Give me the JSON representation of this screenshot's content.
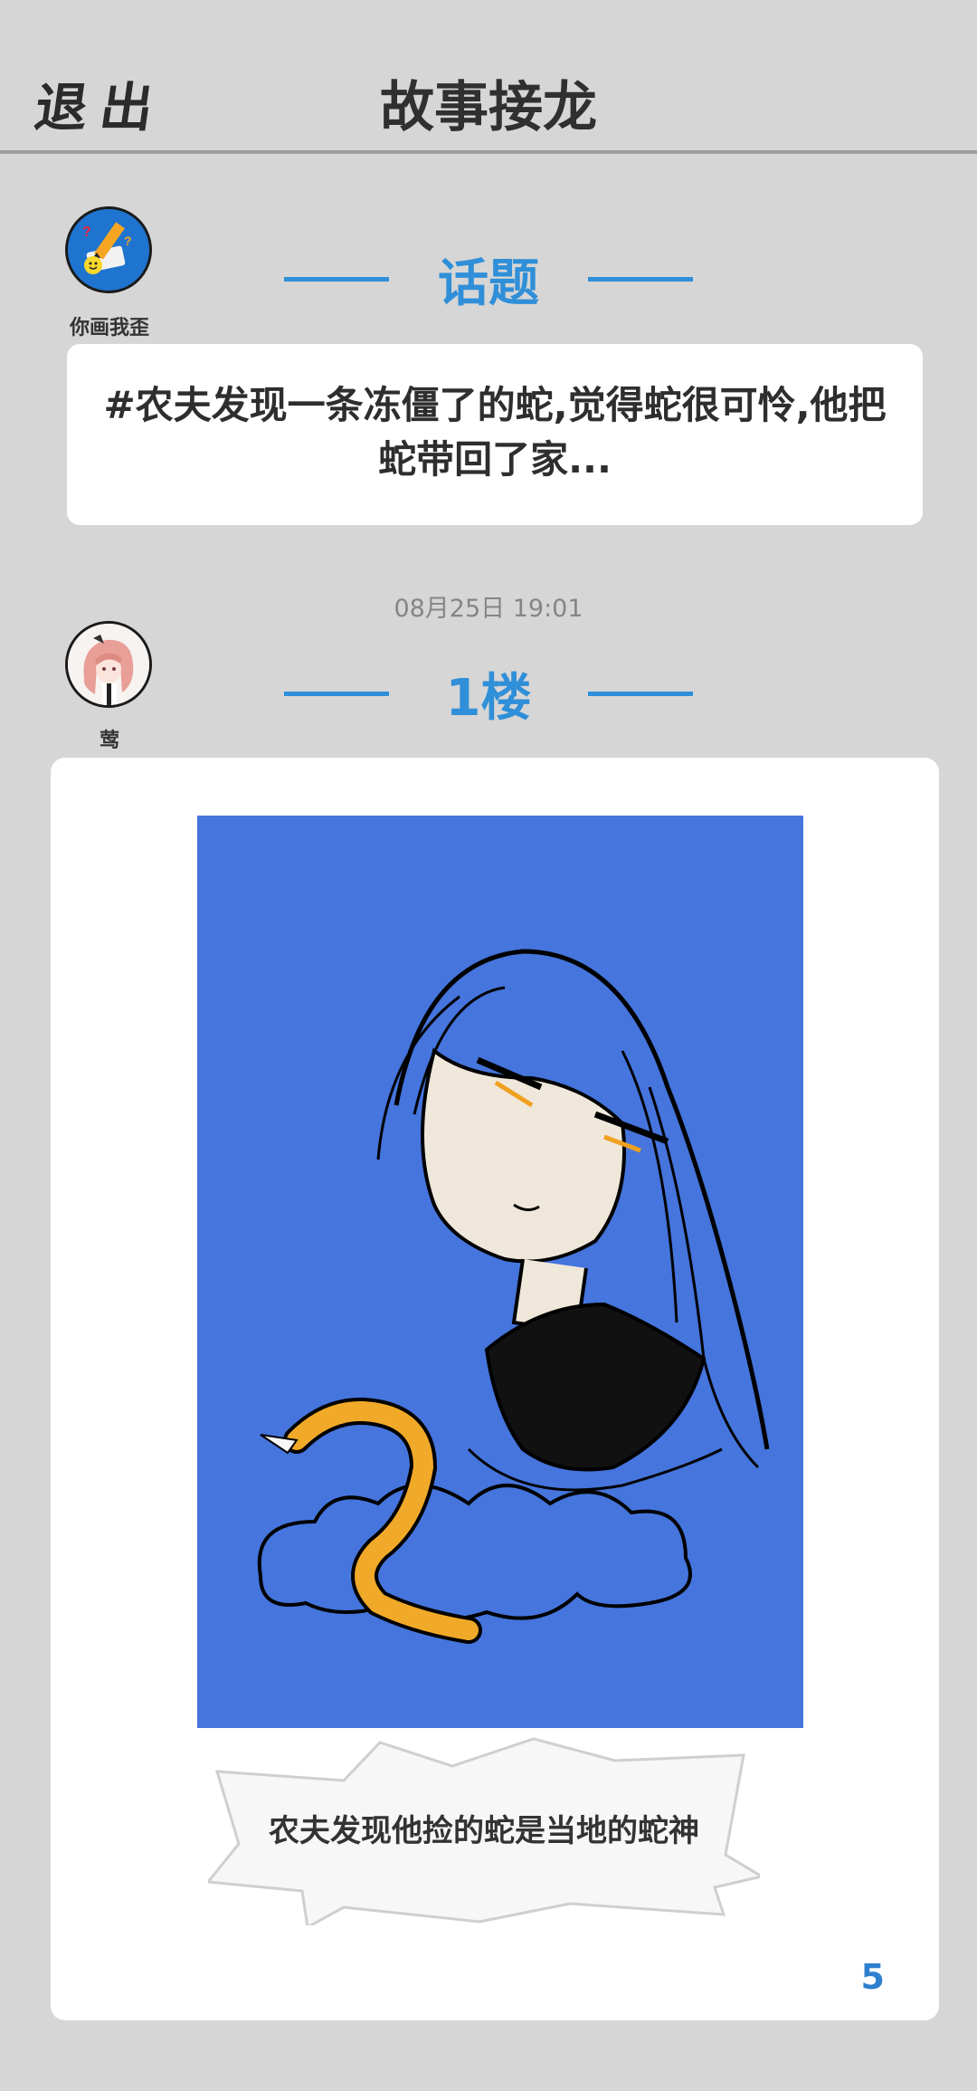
{
  "header": {
    "exit_label": "退出",
    "title": "故事接龙"
  },
  "topic": {
    "author": "你画我歪",
    "section_label": "话题",
    "text": "#农夫发现一条冻僵了的蛇,觉得蛇很可怜,他把蛇带回了家..."
  },
  "post": {
    "timestamp": "08月25日  19:01",
    "author": "莺",
    "section_label": "1楼",
    "caption": "农夫发现他捡的蛇是当地的蛇神",
    "like_count": "5"
  },
  "colors": {
    "accent": "#2f8fd8",
    "background": "#d6d6d6",
    "drawing_bg": "#4575dd",
    "like": "#2f7fd0"
  }
}
